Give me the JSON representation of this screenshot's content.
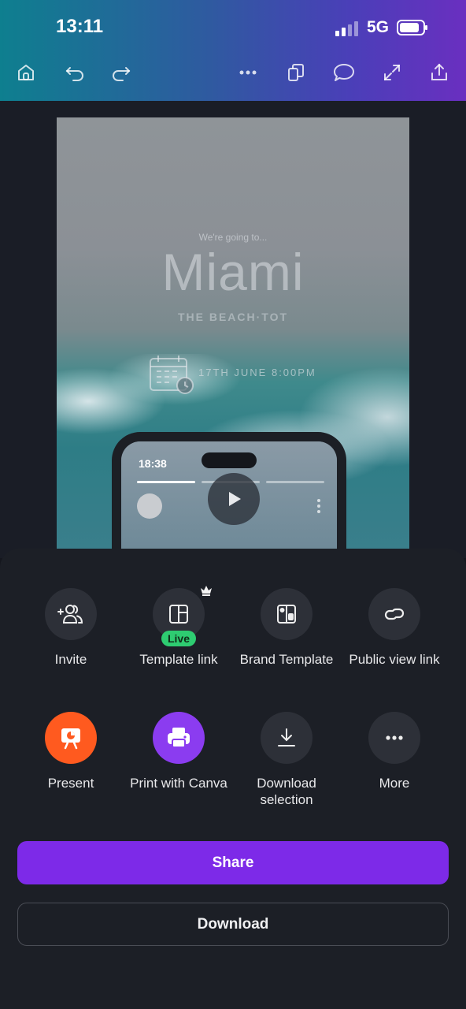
{
  "status": {
    "time": "13:11",
    "network": "5G"
  },
  "toolbar": {
    "icons": [
      "home-icon",
      "undo-icon",
      "redo-icon",
      "more-horizontal-icon",
      "pages-icon",
      "comment-icon",
      "expand-icon",
      "share-upload-icon"
    ]
  },
  "design": {
    "tagline": "We're going to...",
    "city": "Miami",
    "subtitle": "THE BEACH·TOT",
    "date": "17TH JUNE 8:00PM",
    "phone_time": "18:38"
  },
  "sheet": {
    "actions": [
      {
        "label": "Invite",
        "icon": "invite-people-icon"
      },
      {
        "label": "Template link",
        "icon": "template-layout-icon",
        "badge": "Live",
        "premium": "crown-icon"
      },
      {
        "label": "Brand Template",
        "icon": "brand-template-icon"
      },
      {
        "label": "Public view link",
        "icon": "link-icon"
      },
      {
        "label": "Present",
        "icon": "present-icon"
      },
      {
        "label": "Print with Canva",
        "icon": "printer-icon"
      },
      {
        "label": "Download selection",
        "icon": "download-icon"
      },
      {
        "label": "More",
        "icon": "more-horizontal-icon"
      }
    ],
    "share_label": "Share",
    "download_label": "Download"
  },
  "colors": {
    "accent": "#7d2ae8",
    "present": "#ff5a1f",
    "print": "#8b3cf0",
    "live": "#2ecc71"
  }
}
